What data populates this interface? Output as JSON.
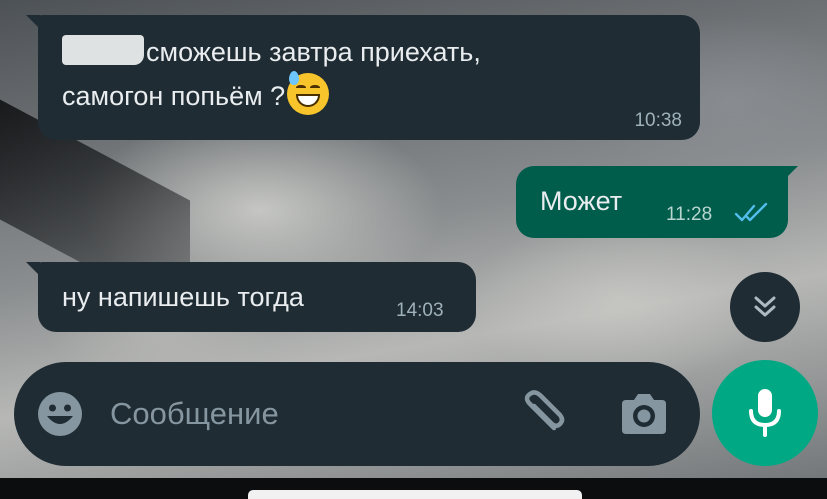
{
  "conversation": {
    "messages": [
      {
        "direction": "incoming",
        "text_line1": "сможешь завтра приехать,",
        "text_line2": "самогон попьём ?",
        "emoji": "grinning-face-with-sweat-icon",
        "time": "10:38"
      },
      {
        "direction": "outgoing",
        "text": "Может",
        "time": "11:28",
        "status": "read",
        "status_icon": "double-check-icon"
      },
      {
        "direction": "incoming",
        "text": "ну напишешь тогда",
        "time": "14:03"
      }
    ]
  },
  "composer": {
    "placeholder": "Сообщение",
    "value": "",
    "icons": [
      "emoji-icon",
      "paperclip-icon",
      "camera-icon"
    ]
  },
  "buttons": {
    "scroll_down_icon": "double-chevron-down-icon",
    "mic_icon": "microphone-icon"
  },
  "colors": {
    "incoming_bubble": "#1f2c33",
    "outgoing_bubble": "#005c4b",
    "accent": "#00a884",
    "read_tick": "#53bdeb",
    "text_primary": "#e9edef",
    "text_secondary": "#8696a0"
  }
}
